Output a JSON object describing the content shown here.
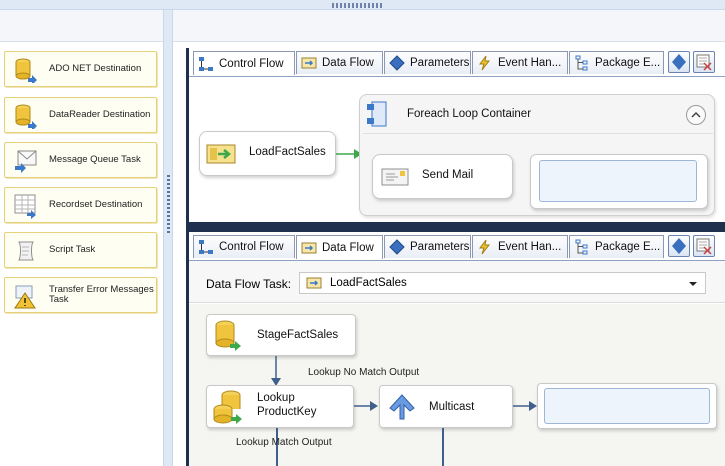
{
  "toolbox": {
    "items": [
      {
        "label": "ADO NET Destination"
      },
      {
        "label": "DataReader Destination"
      },
      {
        "label": "Message Queue Task"
      },
      {
        "label": "Recordset Destination"
      },
      {
        "label": "Script Task"
      },
      {
        "label": "Transfer Error Messages Task"
      }
    ]
  },
  "tabs": {
    "control_flow": "Control Flow",
    "data_flow": "Data Flow",
    "parameters": "Parameters",
    "event_handlers": "Event Han...",
    "package_explorer": "Package E..."
  },
  "control_flow": {
    "load_task": "LoadFactSales",
    "container_title": "Foreach Loop Container",
    "send_mail": "Send Mail"
  },
  "data_flow": {
    "task_label": "Data Flow Task:",
    "task_value": "LoadFactSales",
    "stage": "StageFactSales",
    "lookup_no_match": "Lookup No Match Output",
    "lookup": "Lookup ProductKey",
    "multicast": "Multicast",
    "lookup_match": "Lookup Match Output"
  },
  "colors": {
    "accent": "#1f2f4e",
    "toolbox_item": "#fffef2",
    "canvas": "#f5f5f2",
    "connector": "#40608c"
  }
}
